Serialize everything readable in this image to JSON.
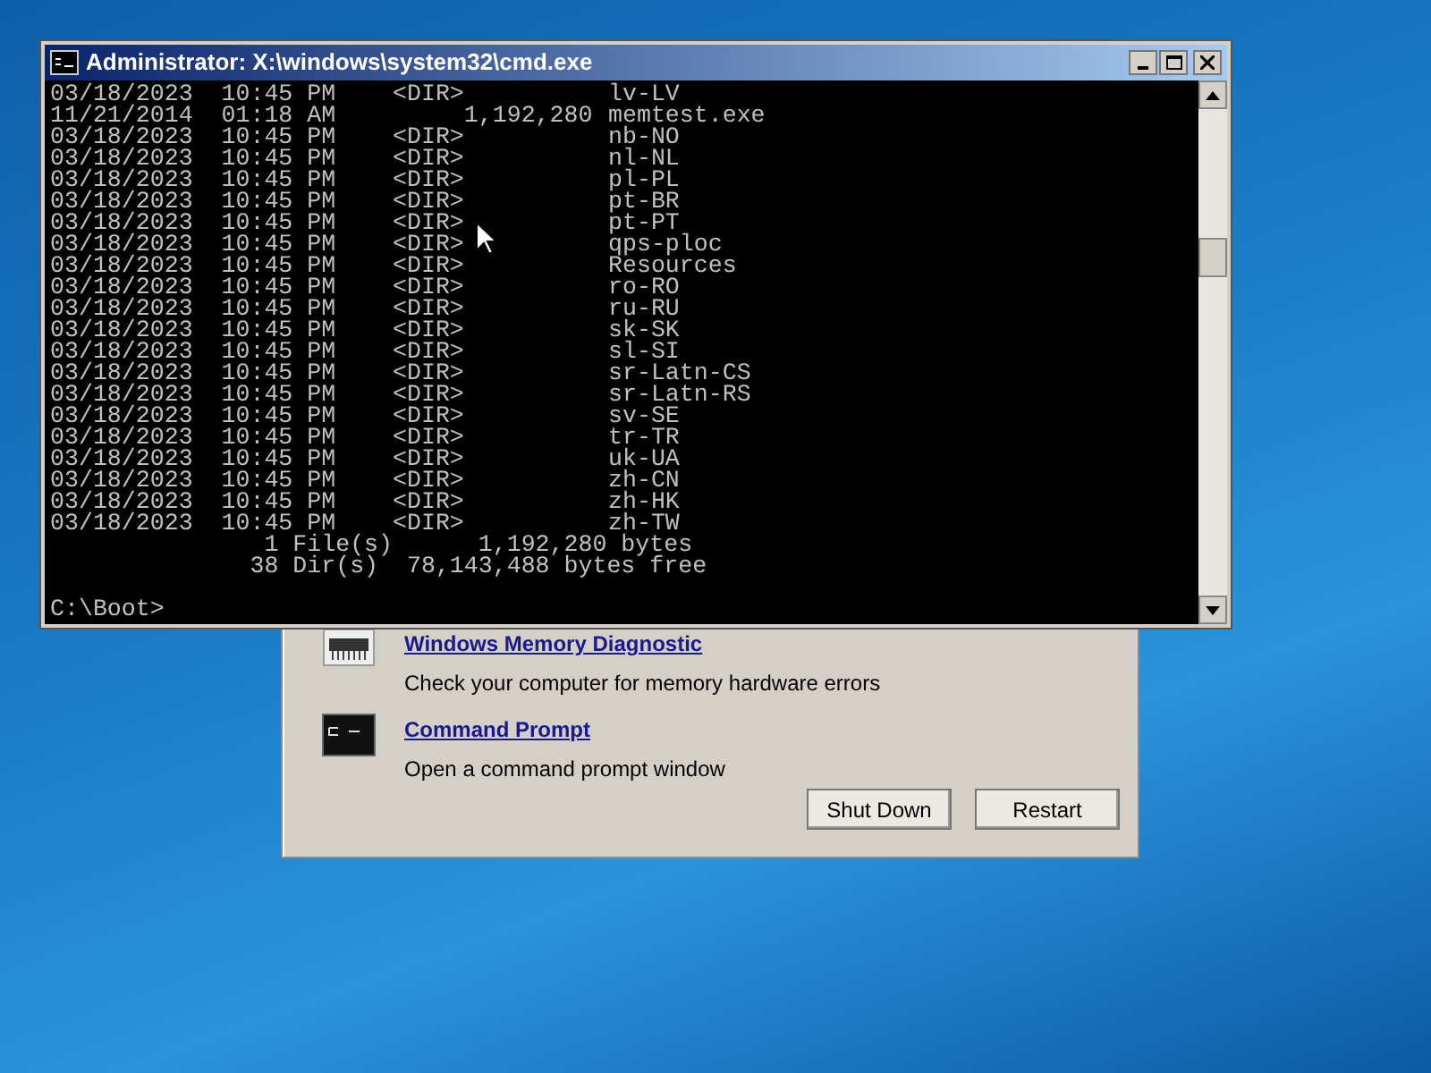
{
  "console_window": {
    "title": "Administrator: X:\\windows\\system32\\cmd.exe",
    "entries": [
      {
        "details": "03/18/2023  10:45 PM    <DIR>",
        "name": "lv-LV"
      },
      {
        "details": "11/21/2014  01:18 AM         1,192,280",
        "name": "memtest.exe"
      },
      {
        "details": "03/18/2023  10:45 PM    <DIR>",
        "name": "nb-NO"
      },
      {
        "details": "03/18/2023  10:45 PM    <DIR>",
        "name": "nl-NL"
      },
      {
        "details": "03/18/2023  10:45 PM    <DIR>",
        "name": "pl-PL"
      },
      {
        "details": "03/18/2023  10:45 PM    <DIR>",
        "name": "pt-BR"
      },
      {
        "details": "03/18/2023  10:45 PM    <DIR>",
        "name": "pt-PT"
      },
      {
        "details": "03/18/2023  10:45 PM    <DIR>",
        "name": "qps-ploc"
      },
      {
        "details": "03/18/2023  10:45 PM    <DIR>",
        "name": "Resources"
      },
      {
        "details": "03/18/2023  10:45 PM    <DIR>",
        "name": "ro-RO"
      },
      {
        "details": "03/18/2023  10:45 PM    <DIR>",
        "name": "ru-RU"
      },
      {
        "details": "03/18/2023  10:45 PM    <DIR>",
        "name": "sk-SK"
      },
      {
        "details": "03/18/2023  10:45 PM    <DIR>",
        "name": "sl-SI"
      },
      {
        "details": "03/18/2023  10:45 PM    <DIR>",
        "name": "sr-Latn-CS"
      },
      {
        "details": "03/18/2023  10:45 PM    <DIR>",
        "name": "sr-Latn-RS"
      },
      {
        "details": "03/18/2023  10:45 PM    <DIR>",
        "name": "sv-SE"
      },
      {
        "details": "03/18/2023  10:45 PM    <DIR>",
        "name": "tr-TR"
      },
      {
        "details": "03/18/2023  10:45 PM    <DIR>",
        "name": "uk-UA"
      },
      {
        "details": "03/18/2023  10:45 PM    <DIR>",
        "name": "zh-CN"
      },
      {
        "details": "03/18/2023  10:45 PM    <DIR>",
        "name": "zh-HK"
      },
      {
        "details": "03/18/2023  10:45 PM    <DIR>",
        "name": "zh-TW"
      }
    ],
    "summary": [
      "               1 File(s)      1,192,280 bytes",
      "              38 Dir(s)  78,143,488 bytes free"
    ],
    "prompt": "C:\\Boot>"
  },
  "recovery_dialog": {
    "tools": [
      {
        "kind": "memory",
        "title": "Windows Memory Diagnostic",
        "description": "Check your computer for memory hardware errors"
      },
      {
        "kind": "prompt",
        "title": "Command Prompt",
        "description": "Open a command prompt window"
      }
    ],
    "buttons": [
      "Shut Down",
      "Restart"
    ]
  }
}
